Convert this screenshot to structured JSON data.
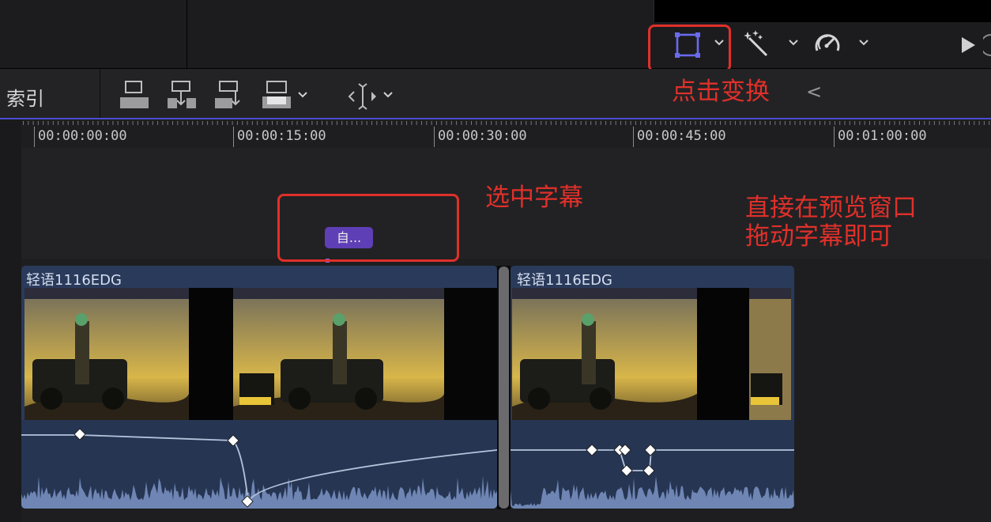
{
  "toolbar": {
    "index_label": "索引",
    "transform_label": "点击变换",
    "back_chevron": "<"
  },
  "ruler": {
    "ticks": [
      "00:00:00:00",
      "00:00:15:00",
      "00:00:30:00",
      "00:00:45:00",
      "00:01:00:00"
    ]
  },
  "timeline": {
    "title_clip_label": "自...",
    "clips": [
      {
        "name": "轻语1116EDG"
      },
      {
        "name": "轻语1116EDG"
      }
    ]
  },
  "annotations": {
    "select_subtitle": "选中字幕",
    "drag_line1": "直接在预览窗口",
    "drag_line2": "拖动字幕即可"
  },
  "icons": [
    "transform-icon",
    "magic-wand-icon",
    "speedometer-icon",
    "play-icon",
    "chevron-down-icon"
  ],
  "colors": {
    "accent": "#4b4bd6",
    "annotation": "#e0302a",
    "title_clip": "#5f3fb5",
    "clip_bg": "#2a3a5a"
  }
}
